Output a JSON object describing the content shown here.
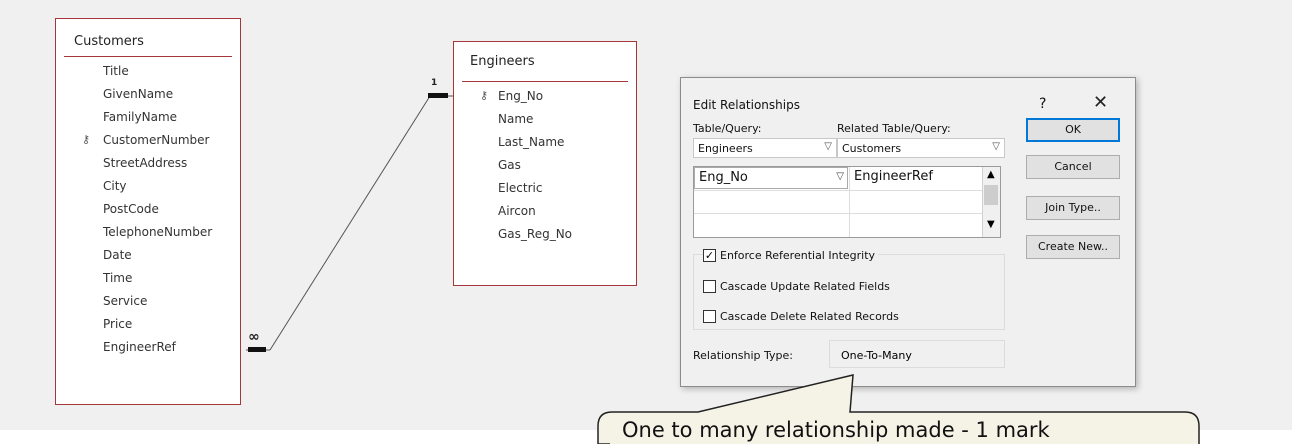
{
  "customers_table": {
    "title": "Customers",
    "fields": [
      "Title",
      "GivenName",
      "FamilyName",
      "CustomerNumber",
      "StreetAddress",
      "City",
      "PostCode",
      "TelephoneNumber",
      "Date",
      "Time",
      "Service",
      "Price",
      "EngineerRef"
    ],
    "key_field": "CustomerNumber"
  },
  "engineers_table": {
    "title": "Engineers",
    "fields": [
      "Eng_No",
      "Name",
      "Last_Name",
      "Gas",
      "Electric",
      "Aircon",
      "Gas_Reg_No"
    ],
    "key_field": "Eng_No"
  },
  "relationship_line": {
    "one_label": "1",
    "many_label": "∞"
  },
  "dialog": {
    "title": "Edit Relationships",
    "help_label": "?",
    "close_label": "✕",
    "table_query_label": "Table/Query:",
    "related_table_label": "Related Table/Query:",
    "table_value": "Engineers",
    "related_table_value": "Customers",
    "grid_left": "Eng_No",
    "grid_right": "EngineerRef",
    "buttons": {
      "ok": "OK",
      "cancel": "Cancel",
      "join_type": "Join Type..",
      "create_new": "Create New.."
    },
    "checkboxes": {
      "enforce": {
        "label": "Enforce Referential Integrity",
        "checked": true
      },
      "cascade_update": {
        "label": "Cascade Update Related Fields",
        "checked": false
      },
      "cascade_delete": {
        "label": "Cascade Delete Related Records",
        "checked": false
      }
    },
    "relationship_type_label": "Relationship Type:",
    "relationship_type_value": "One-To-Many"
  },
  "callout": {
    "text": "One to many relationship made - 1 mark"
  },
  "colors": {
    "table_border": "#a4373a",
    "ok_border": "#0078d7",
    "callout_fill": "#f5f2e6"
  }
}
